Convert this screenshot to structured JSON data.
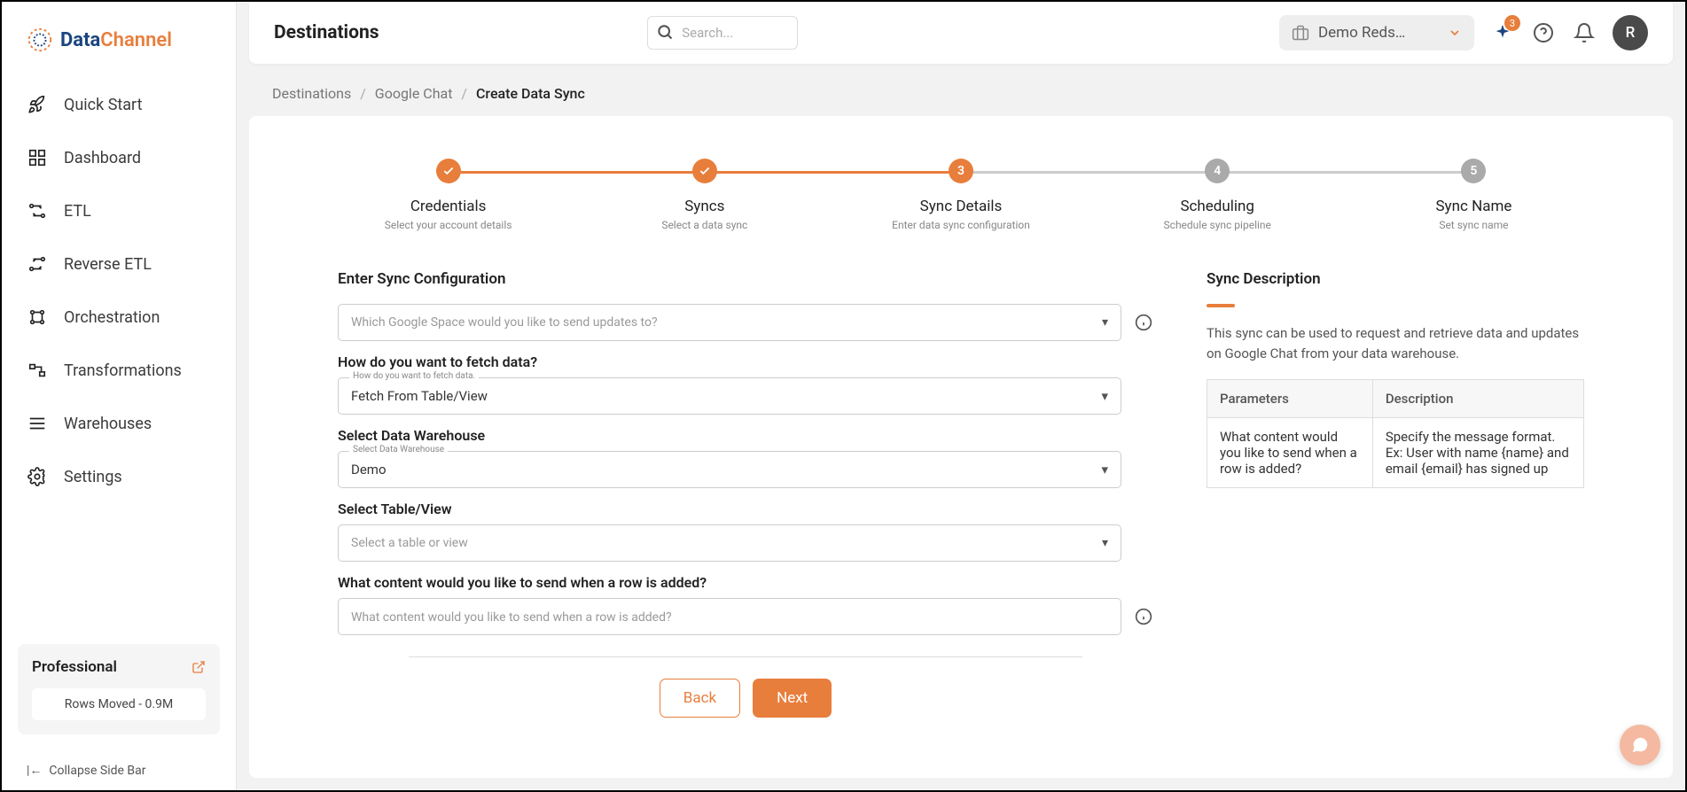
{
  "logo": {
    "text_data": "Data",
    "text_channel": "Channel"
  },
  "sidebar": {
    "items": [
      {
        "label": "Quick Start"
      },
      {
        "label": "Dashboard"
      },
      {
        "label": "ETL"
      },
      {
        "label": "Reverse ETL"
      },
      {
        "label": "Orchestration"
      },
      {
        "label": "Transformations"
      },
      {
        "label": "Warehouses"
      },
      {
        "label": "Settings"
      }
    ],
    "plan": {
      "title": "Professional",
      "rows": "Rows Moved - 0.9M"
    },
    "collapse": "Collapse Side Bar"
  },
  "header": {
    "title": "Destinations",
    "search_placeholder": "Search...",
    "workspace": "Demo Reds…",
    "notif_count": "3",
    "avatar_initial": "R"
  },
  "breadcrumb": {
    "items": [
      "Destinations",
      "Google Chat"
    ],
    "current": "Create Data Sync"
  },
  "stepper": [
    {
      "title": "Credentials",
      "sub": "Select your account details",
      "state": "done",
      "label": "✓"
    },
    {
      "title": "Syncs",
      "sub": "Select a data sync",
      "state": "done",
      "label": "✓"
    },
    {
      "title": "Sync Details",
      "sub": "Enter data sync configuration",
      "state": "active",
      "label": "3"
    },
    {
      "title": "Scheduling",
      "sub": "Schedule sync pipeline",
      "state": "pending",
      "label": "4"
    },
    {
      "title": "Sync Name",
      "sub": "Set sync name",
      "state": "pending",
      "label": "5"
    }
  ],
  "form": {
    "section_title": "Enter Sync Configuration",
    "space_placeholder": "Which Google Space would you like to send updates to?",
    "fetch_label": "How do you want to fetch data?",
    "fetch_float_label": "How do you want to fetch data.",
    "fetch_value": "Fetch From Table/View",
    "warehouse_label": "Select Data Warehouse",
    "warehouse_float_label": "Select Data Warehouse",
    "warehouse_value": "Demo",
    "table_label": "Select Table/View",
    "table_placeholder": "Select a table or view",
    "content_label": "What content would you like to send when a row is added?",
    "content_placeholder": "What content would you like to send when a row is added?"
  },
  "description": {
    "title": "Sync Description",
    "text": "This sync can be used to request and retrieve data and updates on Google Chat from your data warehouse.",
    "headers": [
      "Parameters",
      "Description"
    ],
    "rows": [
      [
        "What content would you like to send when a row is added?",
        "Specify the message format. Ex: User with name {name} and email {email} has signed up"
      ]
    ]
  },
  "buttons": {
    "back": "Back",
    "next": "Next"
  }
}
